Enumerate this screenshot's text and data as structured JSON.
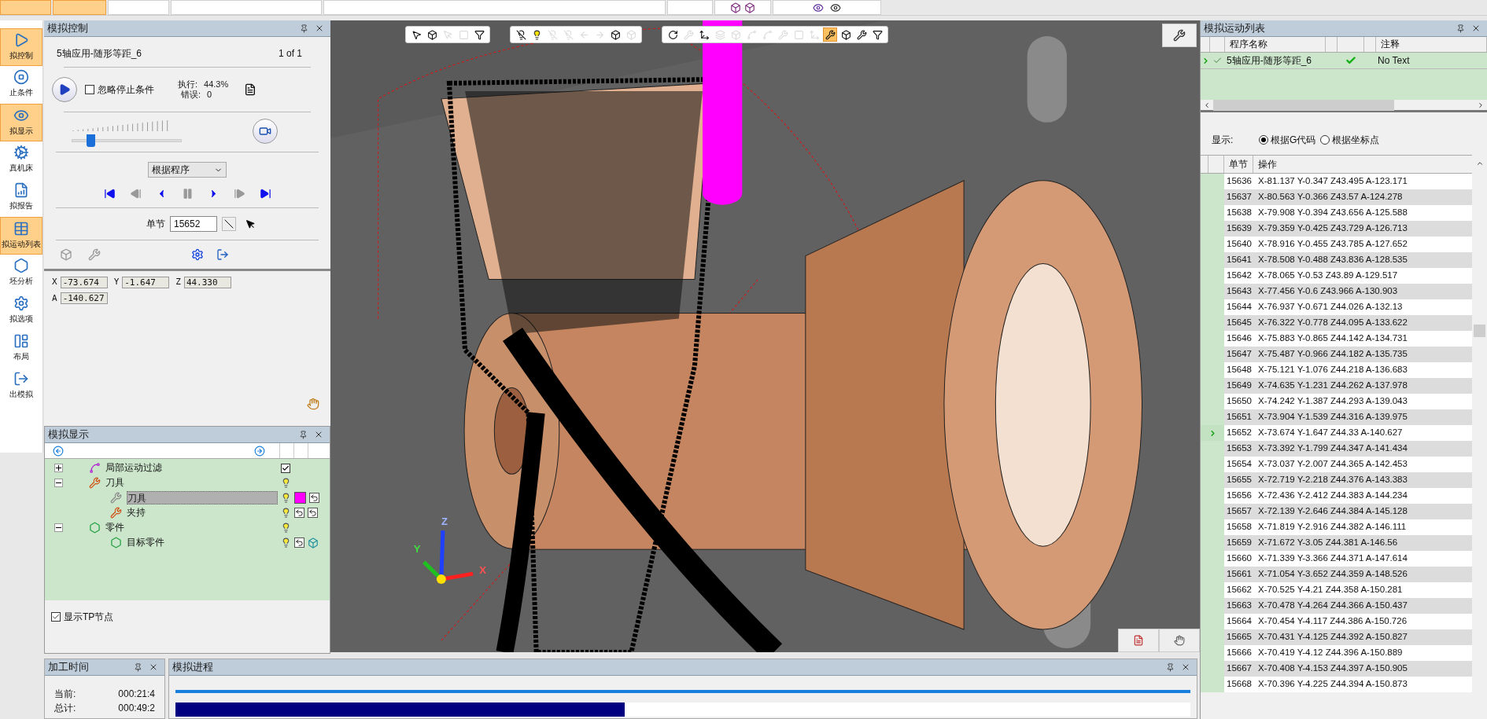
{
  "ribbon": {
    "buttons": [
      {
        "selected": true
      },
      {
        "selected": true
      },
      {
        "selected": false
      },
      {
        "selected": false
      },
      {
        "selected": false
      },
      {
        "selected": false
      }
    ]
  },
  "left_bar": [
    {
      "label": "拟控制",
      "kind": "control",
      "selected": true
    },
    {
      "label": "止条件",
      "kind": "stop",
      "selected": false
    },
    {
      "label": "拟显示",
      "kind": "display",
      "selected": true
    },
    {
      "label": "真机床",
      "kind": "machine",
      "selected": false
    },
    {
      "label": "拟报告",
      "kind": "report",
      "selected": false
    },
    {
      "label": "拟运动列表",
      "kind": "list",
      "selected": true
    },
    {
      "label": "坯分析",
      "kind": "stock",
      "selected": false
    },
    {
      "label": "拟选项",
      "kind": "options",
      "selected": false
    },
    {
      "label": "布局",
      "kind": "layout",
      "selected": false
    },
    {
      "label": "出模拟",
      "kind": "exit",
      "selected": false
    }
  ],
  "control_panel": {
    "title": "模拟控制",
    "program": "5轴应用-随形等距_6",
    "count": "1 of 1",
    "ignore_stop": {
      "label": "忽略停止条件",
      "checked": false
    },
    "exec_label": "执行:",
    "exec_value": "44.3%",
    "error_label": "错误:",
    "error_value": "0",
    "speed": {
      "level": 0.13
    },
    "mode": "根据程序",
    "transport": [
      {
        "kind": "first",
        "disabled": false
      },
      {
        "kind": "prev",
        "disabled": true
      },
      {
        "kind": "step-back",
        "disabled": false
      },
      {
        "kind": "pause",
        "disabled": true
      },
      {
        "kind": "step-forward",
        "disabled": false
      },
      {
        "kind": "next",
        "disabled": true
      },
      {
        "kind": "last",
        "disabled": false
      }
    ],
    "block_label": "单节",
    "block_value": "15652",
    "coords": [
      {
        "axis": "X",
        "value": "-73.674"
      },
      {
        "axis": "Y",
        "value": "-1.647"
      },
      {
        "axis": "Z",
        "value": "44.330"
      },
      {
        "axis": "A",
        "value": "-140.627"
      }
    ]
  },
  "display_panel": {
    "title": "模拟显示",
    "tree": [
      {
        "label": "局部运动过滤",
        "kind": "filter",
        "expanded": false,
        "checked": true
      },
      {
        "label": "刀具",
        "kind": "tool",
        "expanded": true,
        "children": [
          {
            "label": "刀具",
            "kind": "cutter",
            "selected": true,
            "color": "#ff00ff"
          },
          {
            "label": "夹持",
            "kind": "holder",
            "selected": false
          }
        ]
      },
      {
        "label": "零件",
        "kind": "part",
        "expanded": true,
        "children": [
          {
            "label": "目标零件",
            "kind": "part",
            "selected": false
          }
        ]
      }
    ],
    "show_tp": {
      "label": "显示TP节点",
      "checked": true
    }
  },
  "time_panel": {
    "title": "加工时间",
    "current_label": "当前:",
    "current": "000:21:4",
    "total_label": "总计:",
    "total": "000:49:2"
  },
  "progress_panel": {
    "title": "模拟进程",
    "level": 0.443
  },
  "viewport": {
    "toolbars": [
      [
        {
          "kind": "select",
          "disabled": false,
          "selected": false
        },
        {
          "kind": "box",
          "disabled": false,
          "selected": false
        },
        {
          "kind": "pointer",
          "disabled": true,
          "selected": false
        },
        {
          "kind": "frame",
          "disabled": true,
          "selected": false
        },
        {
          "kind": "filter",
          "disabled": false,
          "selected": false
        }
      ],
      [
        {
          "kind": "bulb-off",
          "disabled": false,
          "selected": false
        },
        {
          "kind": "bulb",
          "disabled": false,
          "selected": false
        },
        {
          "kind": "bulb-off",
          "disabled": true,
          "selected": false
        },
        {
          "kind": "bulb-off",
          "disabled": true,
          "selected": false
        },
        {
          "kind": "arrow-left",
          "disabled": true,
          "selected": false
        },
        {
          "kind": "arrow-right",
          "disabled": true,
          "selected": false
        },
        {
          "kind": "cube",
          "disabled": false,
          "selected": false
        },
        {
          "kind": "cube",
          "disabled": true,
          "selected": false
        }
      ],
      [
        {
          "kind": "rotate",
          "disabled": false,
          "selected": false
        },
        {
          "kind": "tool",
          "disabled": true,
          "selected": false
        },
        {
          "kind": "axis",
          "disabled": false,
          "selected": false
        },
        {
          "kind": "layers",
          "disabled": true,
          "selected": false
        },
        {
          "kind": "box",
          "disabled": true,
          "selected": false
        },
        {
          "kind": "path",
          "disabled": true,
          "selected": false
        },
        {
          "kind": "path",
          "disabled": true,
          "selected": false
        },
        {
          "kind": "tool",
          "disabled": true,
          "selected": false
        },
        {
          "kind": "frame",
          "disabled": true,
          "selected": false
        },
        {
          "kind": "axis",
          "disabled": true,
          "selected": false
        },
        {
          "kind": "tool",
          "disabled": false,
          "selected": true
        },
        {
          "kind": "cube",
          "disabled": false,
          "selected": false
        },
        {
          "kind": "tool",
          "disabled": false,
          "selected": false
        },
        {
          "kind": "filter",
          "disabled": false,
          "selected": false
        }
      ]
    ],
    "axes": [
      "X",
      "Y",
      "Z"
    ]
  },
  "motion_panel": {
    "title": "模拟运动列表",
    "columns": [
      "程序名称",
      "注释"
    ],
    "programs": [
      {
        "name": "5轴应用-随形等距_6",
        "done": true,
        "note": "No Text",
        "selected": true
      }
    ],
    "display_label": "显示:",
    "options": [
      {
        "label": "根据G代码",
        "selected": true
      },
      {
        "label": "根据坐标点",
        "selected": false
      }
    ],
    "table_columns": [
      "单节",
      "操作"
    ],
    "rows": [
      {
        "block": "15636",
        "op": "X-81.137 Y-0.347 Z43.495 A-123.171",
        "current": false
      },
      {
        "block": "15637",
        "op": "X-80.563 Y-0.366 Z43.57 A-124.278",
        "current": false
      },
      {
        "block": "15638",
        "op": "X-79.908 Y-0.394 Z43.656 A-125.588",
        "current": false
      },
      {
        "block": "15639",
        "op": "X-79.359 Y-0.425 Z43.729 A-126.713",
        "current": false
      },
      {
        "block": "15640",
        "op": "X-78.916 Y-0.455 Z43.785 A-127.652",
        "current": false
      },
      {
        "block": "15641",
        "op": "X-78.508 Y-0.488 Z43.836 A-128.535",
        "current": false
      },
      {
        "block": "15642",
        "op": "X-78.065 Y-0.53 Z43.89 A-129.517",
        "current": false
      },
      {
        "block": "15643",
        "op": "X-77.456 Y-0.6 Z43.966 A-130.903",
        "current": false
      },
      {
        "block": "15644",
        "op": "X-76.937 Y-0.671 Z44.026 A-132.13",
        "current": false
      },
      {
        "block": "15645",
        "op": "X-76.322 Y-0.778 Z44.095 A-133.622",
        "current": false
      },
      {
        "block": "15646",
        "op": "X-75.883 Y-0.865 Z44.142 A-134.731",
        "current": false
      },
      {
        "block": "15647",
        "op": "X-75.487 Y-0.966 Z44.182 A-135.735",
        "current": false
      },
      {
        "block": "15648",
        "op": "X-75.121 Y-1.076 Z44.218 A-136.683",
        "current": false
      },
      {
        "block": "15649",
        "op": "X-74.635 Y-1.231 Z44.262 A-137.978",
        "current": false
      },
      {
        "block": "15650",
        "op": "X-74.242 Y-1.387 Z44.293 A-139.043",
        "current": false
      },
      {
        "block": "15651",
        "op": "X-73.904 Y-1.539 Z44.316 A-139.975",
        "current": false
      },
      {
        "block": "15652",
        "op": "X-73.674 Y-1.647 Z44.33 A-140.627",
        "current": true
      },
      {
        "block": "15653",
        "op": "X-73.392 Y-1.799 Z44.347 A-141.434",
        "current": false
      },
      {
        "block": "15654",
        "op": "X-73.037 Y-2.007 Z44.365 A-142.453",
        "current": false
      },
      {
        "block": "15655",
        "op": "X-72.719 Y-2.218 Z44.376 A-143.383",
        "current": false
      },
      {
        "block": "15656",
        "op": "X-72.436 Y-2.412 Z44.383 A-144.234",
        "current": false
      },
      {
        "block": "15657",
        "op": "X-72.139 Y-2.646 Z44.384 A-145.128",
        "current": false
      },
      {
        "block": "15658",
        "op": "X-71.819 Y-2.916 Z44.382 A-146.111",
        "current": false
      },
      {
        "block": "15659",
        "op": "X-71.672 Y-3.05 Z44.381 A-146.56",
        "current": false
      },
      {
        "block": "15660",
        "op": "X-71.339 Y-3.366 Z44.371 A-147.614",
        "current": false
      },
      {
        "block": "15661",
        "op": "X-71.054 Y-3.652 Z44.359 A-148.526",
        "current": false
      },
      {
        "block": "15662",
        "op": "X-70.525 Y-4.21 Z44.358 A-150.281",
        "current": false
      },
      {
        "block": "15663",
        "op": "X-70.478 Y-4.264 Z44.366 A-150.437",
        "current": false
      },
      {
        "block": "15664",
        "op": "X-70.454 Y-4.117 Z44.386 A-150.726",
        "current": false
      },
      {
        "block": "15665",
        "op": "X-70.431 Y-4.125 Z44.392 A-150.827",
        "current": false
      },
      {
        "block": "15666",
        "op": "X-70.419 Y-4.12 Z44.396 A-150.889",
        "current": false
      },
      {
        "block": "15667",
        "op": "X-70.408 Y-4.153 Z44.397 A-150.905",
        "current": false
      },
      {
        "block": "15668",
        "op": "X-70.396 Y-4.225 Z44.394 A-150.873",
        "current": false
      }
    ]
  }
}
